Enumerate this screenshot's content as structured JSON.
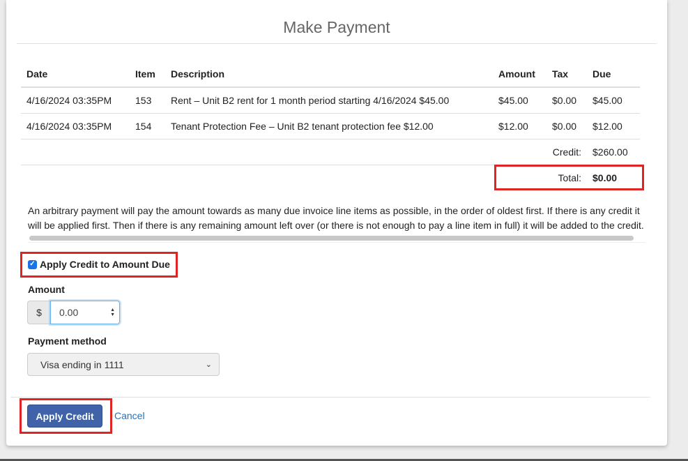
{
  "modal": {
    "title": "Make Payment"
  },
  "table": {
    "headers": [
      "Date",
      "Item",
      "Description",
      "Amount",
      "Tax",
      "Due"
    ],
    "rows": [
      {
        "date": "4/16/2024 03:35PM",
        "item": "153",
        "description": "Rent – Unit B2 rent for 1 month period starting 4/16/2024 $45.00",
        "amount": "$45.00",
        "tax": "$0.00",
        "due": "$45.00"
      },
      {
        "date": "4/16/2024 03:35PM",
        "item": "154",
        "description": "Tenant Protection Fee – Unit B2 tenant protection fee $12.00",
        "amount": "$12.00",
        "tax": "$0.00",
        "due": "$12.00"
      }
    ],
    "credit_label": "Credit:",
    "credit_value": "$260.00",
    "total_label": "Total:",
    "total_value": "$0.00"
  },
  "explanation": "An arbitrary payment will pay the amount towards as many due invoice line items as possible, in the order of oldest first. If there is any credit it will be applied first. Then if there is any remaining amount left over (or there is not enough to pay a line item in full) it will be added to the credit.",
  "form": {
    "apply_credit_label": "Apply Credit to Amount Due",
    "apply_credit_checked": true,
    "amount_label": "Amount",
    "currency_symbol": "$",
    "amount_value": "0.00",
    "payment_method_label": "Payment method",
    "payment_method_selected": "Visa ending in 1111"
  },
  "footer": {
    "apply_button": "Apply Credit",
    "cancel_link": "Cancel"
  },
  "colors": {
    "primary_button": "#3f62a8",
    "link": "#2b71b6",
    "highlight": "#e02323"
  }
}
